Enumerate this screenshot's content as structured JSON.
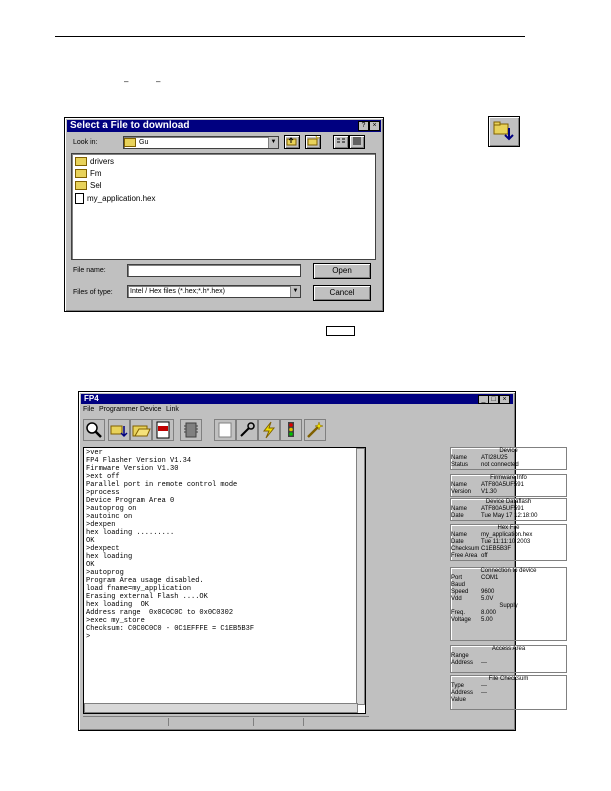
{
  "page": {
    "dash1": "–",
    "dash2": "–"
  },
  "file_dialog": {
    "title": "Select a File to download",
    "help_btn": "?",
    "close_btn": "×",
    "look_in_label": "Look in:",
    "look_in_value": "Gu",
    "items": [
      {
        "name": "drivers",
        "icon": "folder-icon"
      },
      {
        "name": "Fm",
        "icon": "folder-icon"
      },
      {
        "name": "Sel",
        "icon": "folder-icon"
      },
      {
        "name": "my_application.hex",
        "icon": "hex-file-icon"
      }
    ],
    "file_name_label": "File name:",
    "file_name_value": "",
    "file_type_label": "Files of type:",
    "file_type_value": "Intel / Hex files (*.hex;*.h*.hex)",
    "open_btn": "Open",
    "cancel_btn": "Cancel"
  },
  "fp4": {
    "title": "FP4",
    "menu": [
      "File",
      "Programmer",
      "Device",
      "Link"
    ],
    "console_lines": [
      ">ver",
      "FP4 Flasher Version V1.34",
      "Firmware Version V1.30",
      ">ext off",
      "Parallel port in remote control mode",
      ">process",
      "Device Program Area 0",
      ">autoprog on",
      ">autoinc on",
      ">dexpen",
      "hex loading .........",
      "OK",
      ">dexpect",
      "hex loading",
      "OK",
      ">autoprog",
      "Program Area usage disabled.",
      "load fname=my_application",
      "Erasing external Flash ....OK",
      "hex loading  OK",
      "Address range  0x0C0C0C to 0x0C0302",
      ">exec my_store",
      "Checksum: C0C0C0C0 - 0C1EFFFE = C1EB5B3F",
      ">"
    ],
    "panels": {
      "device": {
        "title": "Device",
        "rows": [
          {
            "k": "Name",
            "v": "ATI28U25"
          },
          {
            "k": "Status",
            "v": "not connected"
          }
        ]
      },
      "firmware": {
        "title": "Firmware Info",
        "rows": [
          {
            "k": "Name",
            "v": "ATF80A5UF591"
          },
          {
            "k": "Version",
            "v": "V1.30"
          }
        ]
      },
      "device_dataflash": {
        "title": "Device Dataflash",
        "rows": [
          {
            "k": "Name",
            "v": "ATF80A5UF591"
          },
          {
            "k": "Date",
            "v": "Tue May 17 12:18:00"
          }
        ]
      },
      "hexfile": {
        "title": "Hex File",
        "rows": [
          {
            "k": "Name",
            "v": "my_application.hex"
          },
          {
            "k": "Date",
            "v": "Tue 11:11:10 2003"
          },
          {
            "k": "Checksum",
            "v": "C1EB5B3F"
          },
          {
            "k": "Free Area",
            "v": "off"
          }
        ]
      },
      "connection": {
        "title": "Connection to device",
        "rows": [
          {
            "k": "Port",
            "v": "COM1"
          },
          {
            "k": "Baud",
            "v": ""
          },
          {
            "k": "Speed",
            "v": "9600"
          },
          {
            "k": "Vdd",
            "v": "5.0V"
          }
        ],
        "supply_title": "Supply",
        "supply_rows": [
          {
            "k": "Freq.",
            "v": "8.000"
          },
          {
            "k": "Voltage",
            "v": "5.00"
          }
        ]
      },
      "access": {
        "title": "Access Area",
        "rows": [
          {
            "k": "Range",
            "v": ""
          },
          {
            "k": "Address",
            "v": "---"
          }
        ]
      },
      "file_checksum": {
        "title": "File Checksum",
        "rows": [
          {
            "k": "Type",
            "v": "---"
          },
          {
            "k": "Address",
            "v": "---"
          },
          {
            "k": "Value",
            "v": ""
          }
        ]
      }
    }
  }
}
